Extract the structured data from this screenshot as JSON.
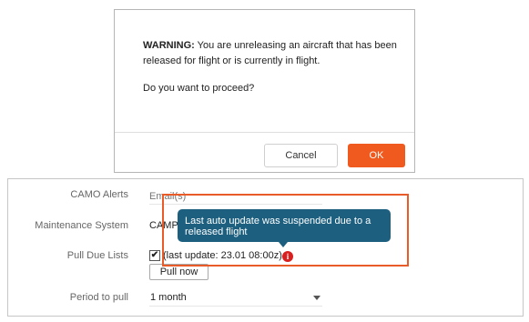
{
  "dialog": {
    "warning_label": "WARNING:",
    "warning_text": " You are unreleasing an aircraft that has been released for flight or is currently in flight.",
    "question": "Do you want to proceed?",
    "cancel_label": "Cancel",
    "ok_label": "OK",
    "ok_color": "#f05a1e"
  },
  "settings": {
    "camo_alerts": {
      "label": "CAMO Alerts",
      "placeholder": "Email(s)"
    },
    "maintenance_system": {
      "label": "Maintenance System",
      "value": "CAMP"
    },
    "pull_due_lists": {
      "label": "Pull Due Lists",
      "checked": true,
      "check_glyph": "✔",
      "last_update": "(last update: 23.01 08:00z)",
      "info_icon_glyph": "i",
      "pull_now_label": "Pull now"
    },
    "period_to_pull": {
      "label": "Period to pull",
      "value": "1 month"
    }
  },
  "tooltip": {
    "text": "Last auto update was suspended due to a released flight",
    "color": "#1c5f7f"
  },
  "highlight_color": "#ea5b2a"
}
